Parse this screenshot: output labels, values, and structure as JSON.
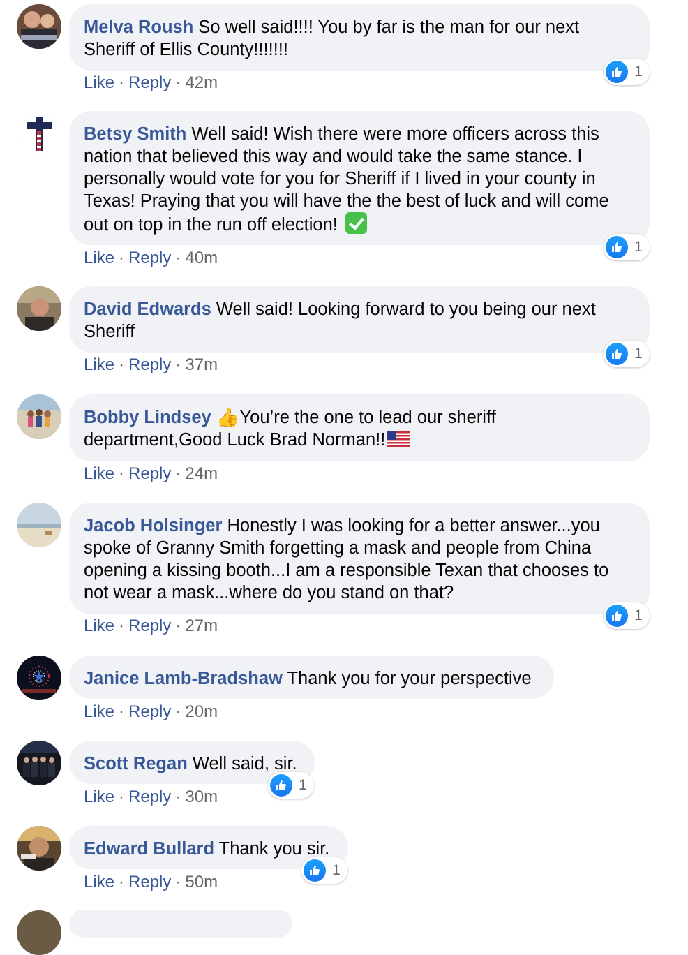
{
  "comments": [
    {
      "author": "Melva Roush",
      "text": "So well said!!!! You by far is the man for our next Sheriff of Ellis County!!!!!!!",
      "actions": {
        "like": "Like",
        "reply": "Reply",
        "time": "42m"
      },
      "reaction_count": "1",
      "avatar_icon": "profile-photo-icon"
    },
    {
      "author": "Betsy Smith",
      "text": "Well said! Wish there were more officers across this nation that believed this way and would take the same stance. I personally would vote for you for Sheriff if I lived in your county in Texas! Praying that you will have the the best of luck and will come out on top in the run off election!",
      "emoji": "white-heavy-check-mark",
      "actions": {
        "like": "Like",
        "reply": "Reply",
        "time": "40m"
      },
      "reaction_count": "1",
      "avatar_icon": "cross-flag-icon"
    },
    {
      "author": "David Edwards",
      "text": "Well said! Looking forward to you being our next Sheriff",
      "actions": {
        "like": "Like",
        "reply": "Reply",
        "time": "37m"
      },
      "reaction_count": "1",
      "avatar_icon": "profile-photo-icon"
    },
    {
      "author": "Bobby Lindsey",
      "text_before_emoji": "",
      "text": "You’re the one to lead our sheriff department,Good Luck Brad Norman!!",
      "emoji_lead": "thumbs-up",
      "emoji_trail": "us-flag",
      "actions": {
        "like": "Like",
        "reply": "Reply",
        "time": "24m"
      },
      "avatar_icon": "profile-photo-icon"
    },
    {
      "author": "Jacob Holsinger",
      "text": "Honestly I was looking for a better answer...you spoke of Granny Smith forgetting a mask and people from China opening a kissing booth...I am a responsible Texan that chooses to not wear a mask...where do you stand on that?",
      "actions": {
        "like": "Like",
        "reply": "Reply",
        "time": "27m"
      },
      "reaction_count": "1",
      "avatar_icon": "beach-photo-icon"
    },
    {
      "author": "Janice Lamb-Bradshaw",
      "text": "Thank you for your perspective",
      "actions": {
        "like": "Like",
        "reply": "Reply",
        "time": "20m"
      },
      "avatar_icon": "fireworks-photo-icon"
    },
    {
      "author": "Scott Regan",
      "text": "Well said, sir.",
      "actions": {
        "like": "Like",
        "reply": "Reply",
        "time": "30m"
      },
      "reaction_count": "1",
      "avatar_icon": "group-photo-icon"
    },
    {
      "author": "Edward Bullard",
      "text": "Thank you sir.",
      "actions": {
        "like": "Like",
        "reply": "Reply",
        "time": "50m"
      },
      "reaction_count": "1",
      "avatar_icon": "profile-photo-icon"
    }
  ],
  "colors": {
    "author": "#385898",
    "bubble": "#f0f2f5",
    "meta": "#65676b",
    "like_blue": "#1877f2"
  }
}
